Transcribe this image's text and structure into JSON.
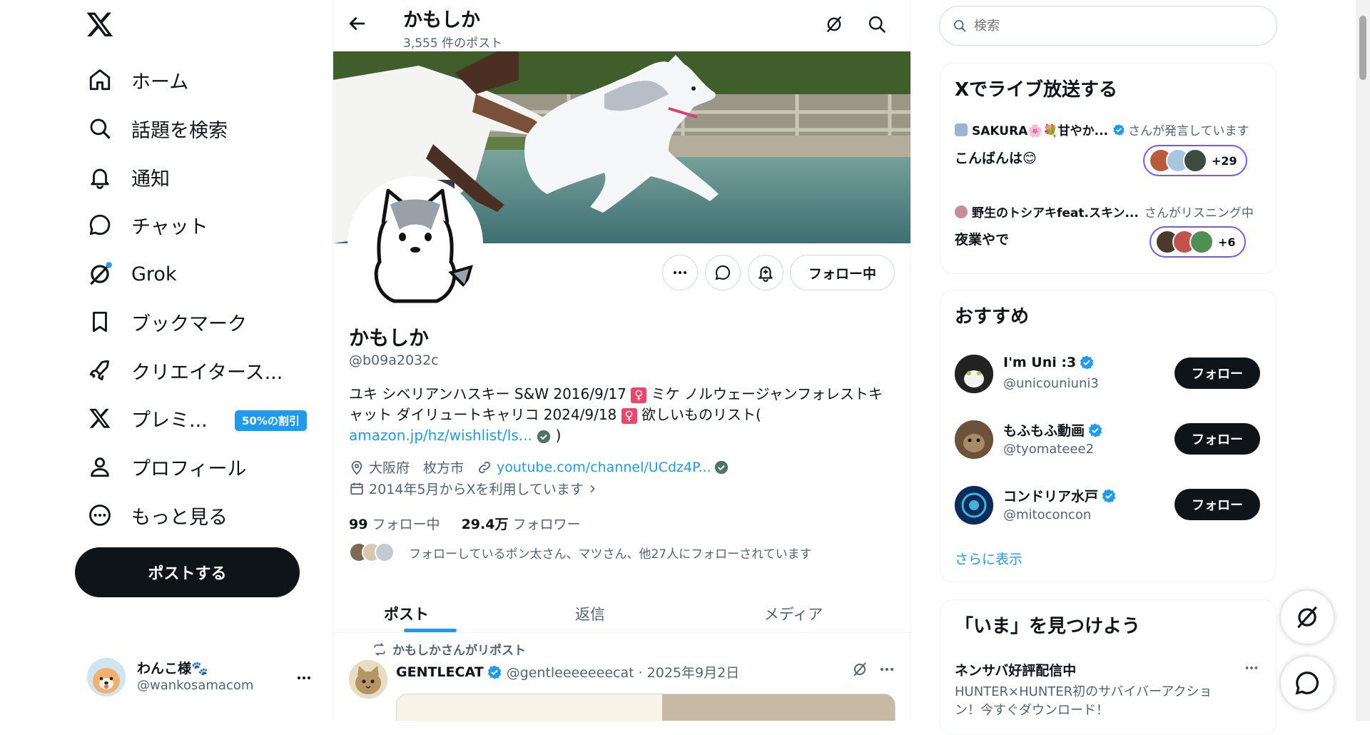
{
  "colors": {
    "accent": "#1d9bf0",
    "text": "#0f1419",
    "muted": "#536471",
    "border": "#eff3f4",
    "badge": "#1d9bf0",
    "live_ring": "#7856ff",
    "female_sign_bg": "#f4436b"
  },
  "nav": {
    "items": [
      {
        "label": "ホーム",
        "icon": "home-icon"
      },
      {
        "label": "話題を検索",
        "icon": "search-icon"
      },
      {
        "label": "通知",
        "icon": "bell-icon"
      },
      {
        "label": "チャット",
        "icon": "chat-icon"
      },
      {
        "label": "Grok",
        "icon": "grok-icon"
      },
      {
        "label": "ブックマーク",
        "icon": "bookmark-icon"
      },
      {
        "label": "クリエイタース...",
        "icon": "rocket-icon"
      },
      {
        "label": "プレミ...",
        "icon": "x-logo-icon"
      },
      {
        "label": "プロフィール",
        "icon": "person-icon"
      },
      {
        "label": "もっと見る",
        "icon": "more-circle-icon"
      }
    ],
    "premium_badge": "50%の割引",
    "post_button": "ポストする",
    "account": {
      "name": "わんこ様🐾",
      "handle": "@wankosamacom"
    }
  },
  "profile": {
    "header_name": "かもしか",
    "post_count": "3,555 件のポスト",
    "name": "かもしか",
    "handle": "@b09a2032c",
    "bio_line1": "ユキ シベリアンハスキー S&W 2016/9/17",
    "bio_line1b": "ミケ ノルウェージャンフォレストキ",
    "bio_line2": "ャット ダイリュートキャリコ 2024/9/18",
    "bio_line2b": "欲しいものリスト(",
    "bio_link": "amazon.jp/hz/wishlist/ls...",
    "bio_end": ")",
    "female_sign": "♀",
    "location": "大阪府　枚方市",
    "website": "youtube.com/channel/UCdz4P...",
    "joined": "2014年5月からXを利用しています",
    "following_count": "99",
    "following_label": "フォロー中",
    "followers_count": "29.4万",
    "followers_label": "フォロワー",
    "followed_by": "フォローしているポン太さん、マツさん、他27人にフォローされています",
    "follow_status": "フォロー中"
  },
  "tabs": [
    {
      "label": "ポスト"
    },
    {
      "label": "返信"
    },
    {
      "label": "メディア"
    }
  ],
  "post": {
    "repost_label": "かもしかさんがリポスト",
    "author": "GENTLECAT",
    "handle_date": "@gentleeeeeeecat · 2025年9月2日"
  },
  "search": {
    "placeholder": "検索"
  },
  "live": {
    "title": "Xでライブ放送する",
    "items": [
      {
        "host": "SAKURA🌸💐甘やか...",
        "status": "さんが発言しています",
        "title": "こんばんは😊",
        "count": "+29"
      },
      {
        "host": "野生のトシアキfeat.スキン...",
        "status": "さんがリスニング中",
        "title": "夜業やで",
        "count": "+6"
      }
    ]
  },
  "suggest": {
    "title": "おすすめ",
    "items": [
      {
        "name": "I'm Uni :3",
        "handle": "@unicouniuni3",
        "button": "フォロー"
      },
      {
        "name": "もふもふ動画",
        "handle": "@tyomateee2",
        "button": "フォロー"
      },
      {
        "name": "コンドリア水戸",
        "handle": "@mitoconcon",
        "button": "フォロー"
      }
    ],
    "show_more": "さらに表示"
  },
  "trends": {
    "title": "「いま」を見つけよう",
    "item_title": "ネンサバ好評配信中",
    "item_desc1": "HUNTER×HUNTER初のサバイバーアクショ",
    "item_desc2": "ン！今すぐダウンロード！"
  }
}
